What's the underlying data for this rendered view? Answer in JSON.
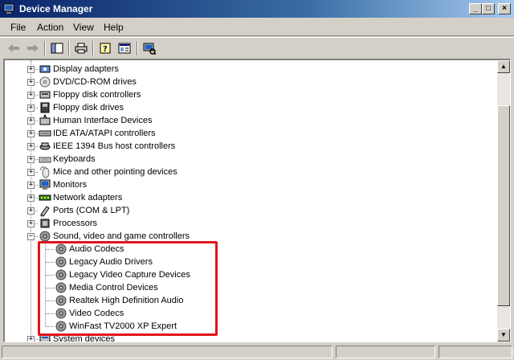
{
  "window": {
    "title": "Device Manager"
  },
  "menu": [
    "File",
    "Action",
    "View",
    "Help"
  ],
  "window_buttons": {
    "minimize": "_",
    "maximize": "□",
    "close": "×"
  },
  "toolbar": {
    "icons": [
      "back-arrow-icon",
      "forward-arrow-icon",
      "show-hide-console-tree-icon",
      "print-icon",
      "help-icon",
      "properties-icon",
      "scan-hardware-icon"
    ]
  },
  "tree": {
    "categories": [
      {
        "label": "Display adapters",
        "icon": "display-adapter-icon",
        "expander": "+"
      },
      {
        "label": "DVD/CD-ROM drives",
        "icon": "dvd-drive-icon",
        "expander": "+"
      },
      {
        "label": "Floppy disk controllers",
        "icon": "floppy-controller-icon",
        "expander": "+"
      },
      {
        "label": "Floppy disk drives",
        "icon": "floppy-drive-icon",
        "expander": "+"
      },
      {
        "label": "Human Interface Devices",
        "icon": "hid-icon",
        "expander": "+"
      },
      {
        "label": "IDE ATA/ATAPI controllers",
        "icon": "ide-controller-icon",
        "expander": "+"
      },
      {
        "label": "IEEE 1394 Bus host controllers",
        "icon": "ieee1394-icon",
        "expander": "+"
      },
      {
        "label": "Keyboards",
        "icon": "keyboard-icon",
        "expander": "+"
      },
      {
        "label": "Mice and other pointing devices",
        "icon": "mouse-icon",
        "expander": "+"
      },
      {
        "label": "Monitors",
        "icon": "monitor-icon",
        "expander": "+"
      },
      {
        "label": "Network adapters",
        "icon": "network-adapter-icon",
        "expander": "+"
      },
      {
        "label": "Ports (COM & LPT)",
        "icon": "port-icon",
        "expander": "+"
      },
      {
        "label": "Processors",
        "icon": "processor-icon",
        "expander": "+"
      },
      {
        "label": "Sound, video and game controllers",
        "icon": "sound-icon",
        "expander": "−"
      }
    ],
    "sound_children": [
      "Audio Codecs",
      "Legacy Audio Drivers",
      "Legacy Video Capture Devices",
      "Media Control Devices",
      "Realtek High Definition Audio",
      "Video Codecs",
      "WinFast TV2000 XP Expert"
    ],
    "after": {
      "label": "System devices",
      "icon": "system-devices-icon",
      "expander": "+"
    }
  },
  "colors": {
    "highlight_box": "#e0141a",
    "titlebar": "#0a246a"
  }
}
